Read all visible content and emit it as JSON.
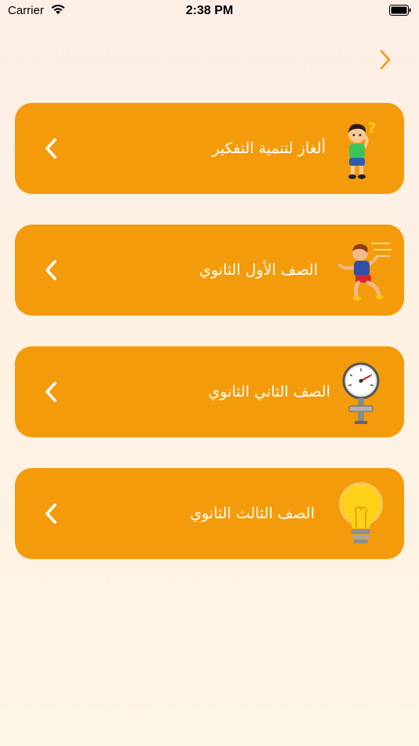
{
  "status_bar": {
    "carrier": "Carrier",
    "time": "2:38 PM"
  },
  "nav": {
    "back_icon": "chevron-right-icon",
    "color": "#f49b0b"
  },
  "menu_items": [
    {
      "label": "ألغاز لتنمية التفكير",
      "icon": "thinking-boy-icon"
    },
    {
      "label": "الصف الأول الثانوي",
      "icon": "running-boy-icon"
    },
    {
      "label": "الصف الثاني الثانوي",
      "icon": "pressure-gauge-icon"
    },
    {
      "label": "الصف الثالث الثانوي",
      "icon": "light-bulb-icon"
    }
  ],
  "colors": {
    "card": "#f49b0b",
    "text": "#ffffff"
  }
}
